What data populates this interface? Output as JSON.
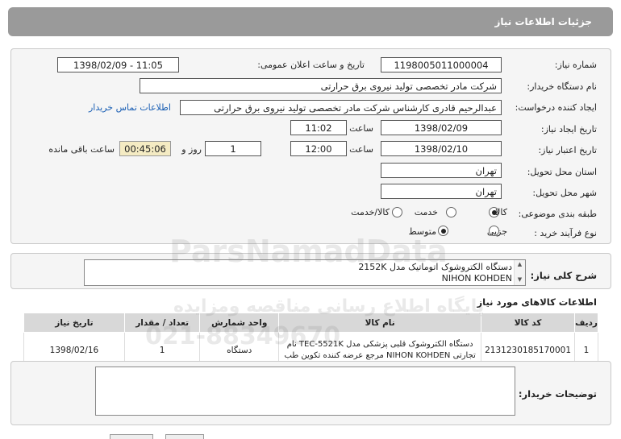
{
  "header": {
    "title": "جزئیات اطلاعات نیاز"
  },
  "form": {
    "need_number_label": "شماره نیاز:",
    "need_number": "1198005011000004",
    "announce_label": "تاریخ و ساعت اعلان عمومی:",
    "announce_value": "1398/02/09 - 11:05",
    "buyer_org_label": "نام دستگاه خریدار:",
    "buyer_org": "شرکت مادر تخصصی تولید نیروی برق حرارتی",
    "requester_label": "ایجاد کننده درخواست:",
    "requester": "عبدالرحیم قادری کارشناس شرکت مادر تخصصی تولید نیروی برق حرارتی",
    "contact_link": "اطلاعات تماس خریدار",
    "created_label": "تاریخ ایجاد نیاز:",
    "created_date": "1398/02/09",
    "time_label": "ساعت",
    "created_time": "11:02",
    "validity_label": "تاریخ اعتبار نیاز:",
    "validity_date": "1398/02/10",
    "validity_time": "12:00",
    "days_value": "1",
    "days_label": "روز و",
    "remaining_time": "00:45:06",
    "remaining_label": "ساعت باقی مانده",
    "province_label": "استان محل تحویل:",
    "province": "تهران",
    "city_label": "شهر محل تحویل:",
    "city": "تهران",
    "category_label": "طبقه بندی موضوعی:",
    "category_options": [
      "کالا",
      "خدمت",
      "کالا/خدمت"
    ],
    "category_selected": "کالا",
    "process_label": "نوع فرآیند خرید :",
    "process_options": [
      "جزیی",
      "متوسط"
    ],
    "process_selected": "متوسط"
  },
  "summary": {
    "label": "شرح کلی نیاز:",
    "line1": "دستگاه الکتروشوک اتوماتیک مدل 2152K",
    "line2": "NIHON KOHDEN"
  },
  "items": {
    "title": "اطلاعات کالاهای مورد نیاز",
    "columns": [
      "ردیف",
      "کد کالا",
      "نام کالا",
      "واحد شمارش",
      "تعداد / مقدار",
      "تاریخ نیاز"
    ],
    "rows": [
      {
        "row": "1",
        "code": "2131230185170001",
        "name": "دستگاه الکتروشوک قلبی پزشکی مدل TEC-5521K نام تجارتی NIHON KOHDEN مرجع عرضه کننده تکوین طب",
        "unit": "دستگاه",
        "qty": "1",
        "date": "1398/02/16"
      }
    ]
  },
  "buyer_notes": {
    "label": "توضیحات خریدار:",
    "value": ""
  },
  "watermark": {
    "main": "ParsNamadData",
    "sub1": "پایگاه اطلاع رسانی مناقصه ومزایده",
    "phone": "021-88349670"
  }
}
